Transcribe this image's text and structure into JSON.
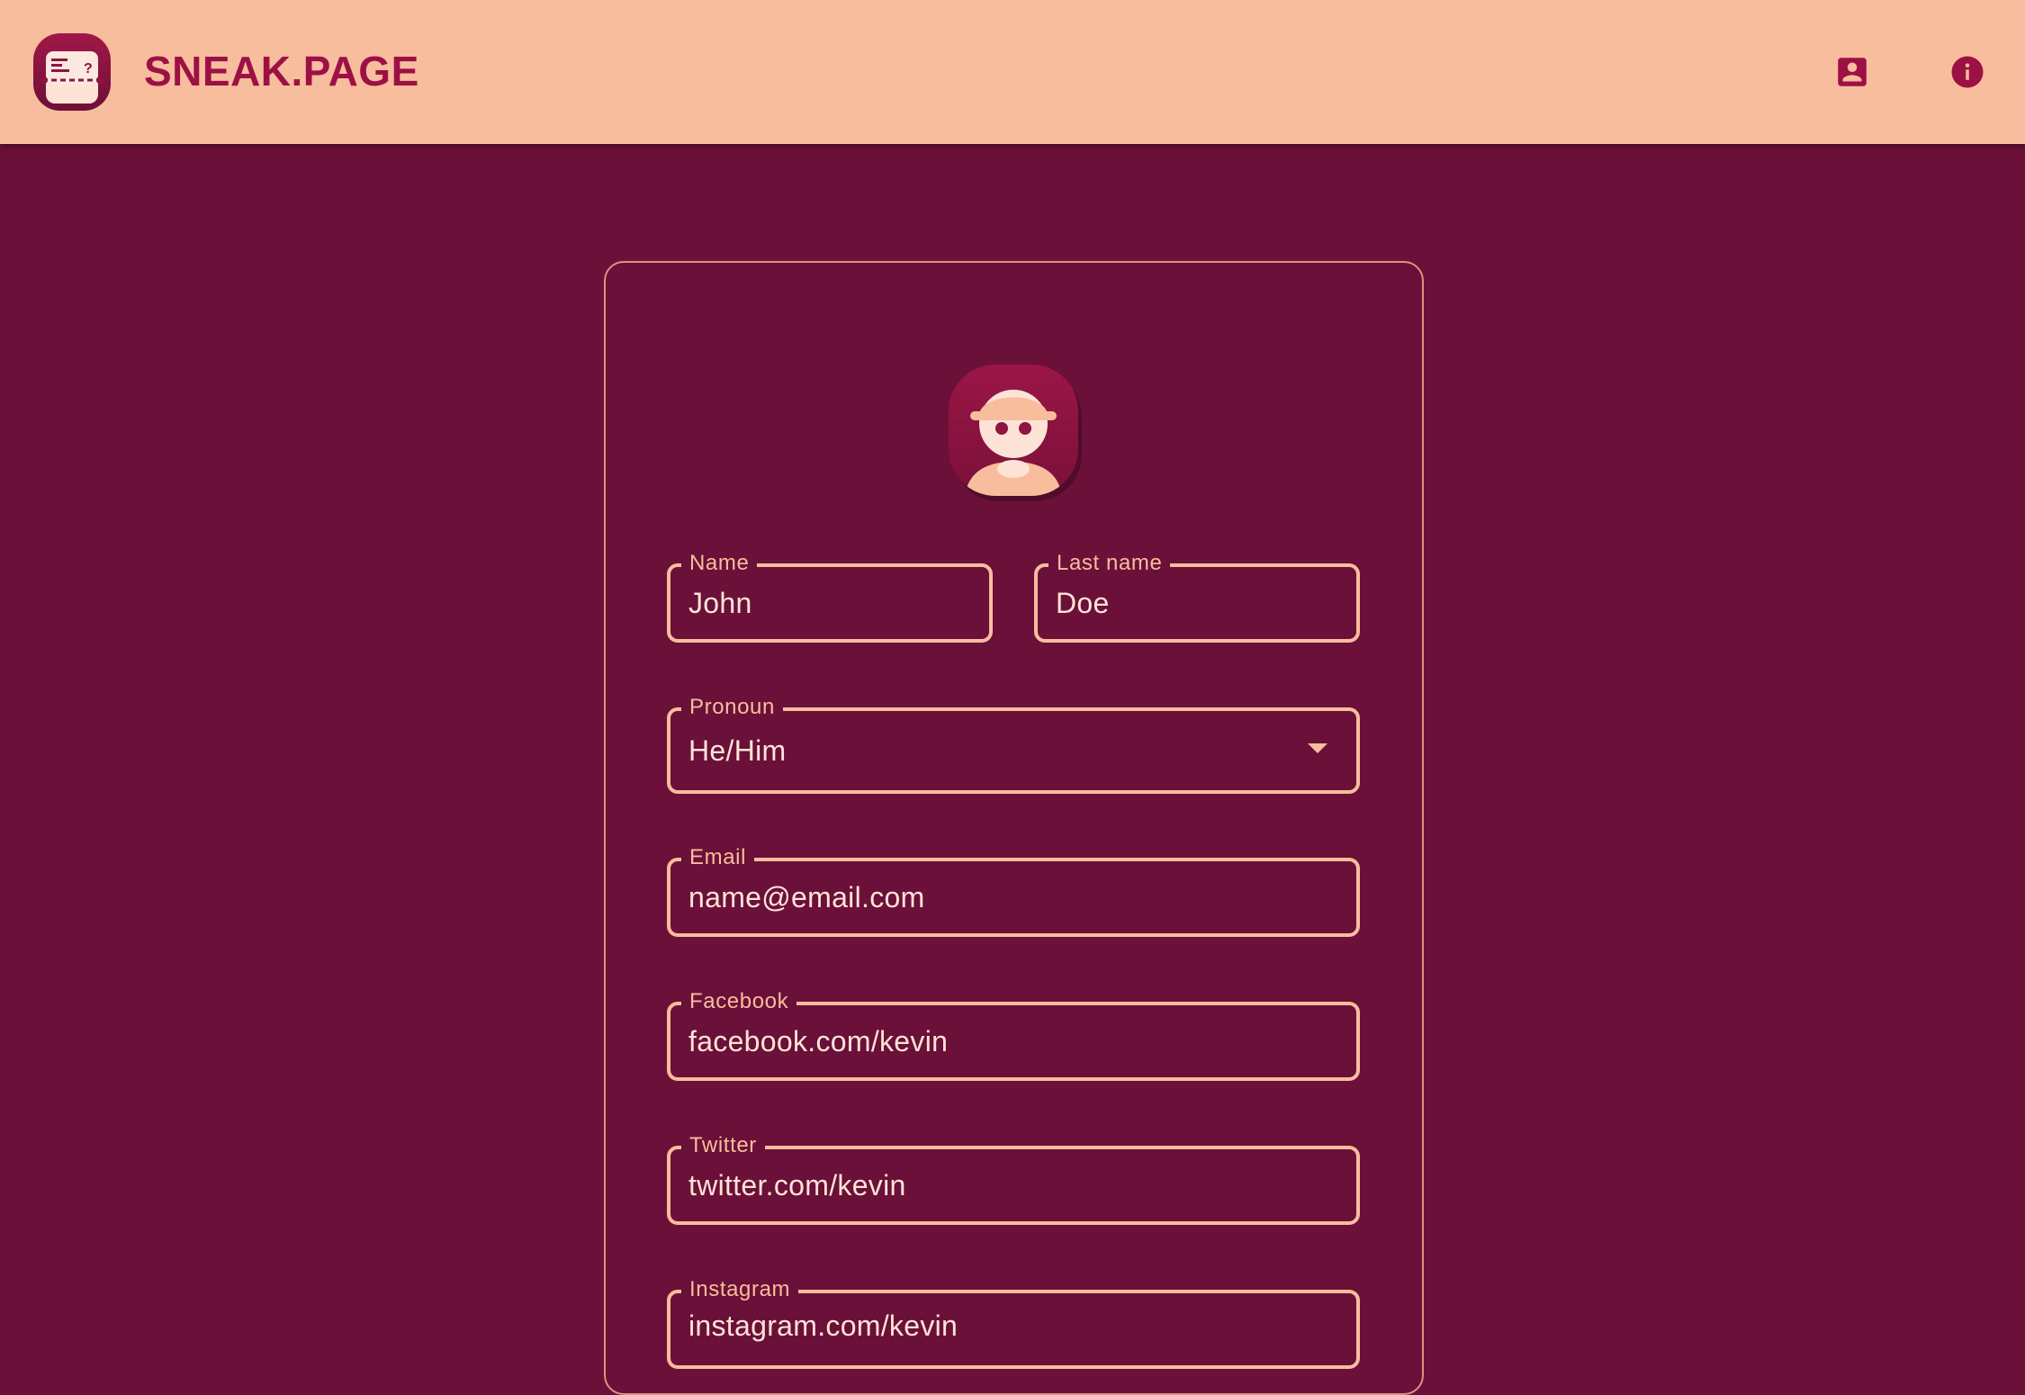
{
  "app": {
    "brand": "SNEAK.PAGE",
    "colors": {
      "appbar": "#f8bd9c",
      "background": "#6b1039",
      "accent": "#9d1046",
      "field_border": "#f8bd9c"
    },
    "icons": [
      "logo-icon",
      "account-box-icon",
      "info-icon",
      "avatar-icon",
      "dropdown-caret-icon"
    ]
  },
  "form": {
    "name": {
      "label": "Name",
      "value": "John"
    },
    "last_name": {
      "label": "Last name",
      "value": "Doe"
    },
    "pronoun": {
      "label": "Pronoun",
      "value": "He/Him"
    },
    "email": {
      "label": "Email",
      "value": "name@email.com"
    },
    "facebook": {
      "label": "Facebook",
      "value": "facebook.com/kevin"
    },
    "twitter": {
      "label": "Twitter",
      "value": "twitter.com/kevin"
    },
    "instagram": {
      "label": "Instagram",
      "value": "instagram.com/kevin"
    }
  }
}
